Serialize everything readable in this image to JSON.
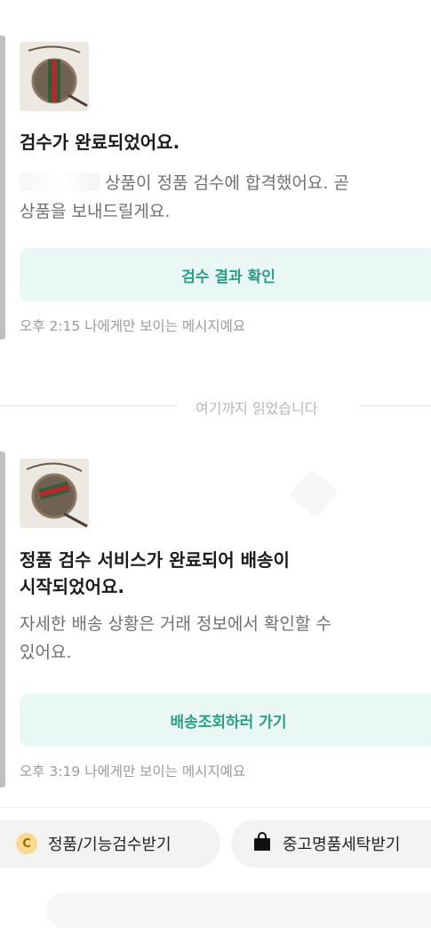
{
  "messages": [
    {
      "title": "검수가 완료되었어요.",
      "body_after_blur": "상품이 정품 검수에 합격했어요. 곧",
      "body_line2": "상품을 보내드릴게요.",
      "cta_label": "검수 결과 확인",
      "time": "오후 2:15",
      "meta_note": "나에게만 보이는 메시지예요"
    },
    {
      "title_line1": "정품 검수 서비스가 완료되어 배송이",
      "title_line2": "시작되었어요.",
      "body_line1": "자세한 배송 상황은 거래 정보에서 확인할 수",
      "body_line2": "있어요.",
      "cta_label": "배송조회하러 가기",
      "time": "오후 3:19",
      "meta_note": "나에게만 보이는 메시지예요"
    }
  ],
  "read_marker": "여기까지 읽었습니다",
  "quick_actions": [
    {
      "label": "정품/기능검수받기",
      "icon": "coin-icon",
      "icon_text": "C"
    },
    {
      "label": "중고명품세탁받기",
      "icon": "shopping-bag-icon"
    }
  ],
  "colors": {
    "accent": "#2b9e85",
    "cta_bg": "#eaf8f5",
    "coin": "#f9d98d"
  }
}
